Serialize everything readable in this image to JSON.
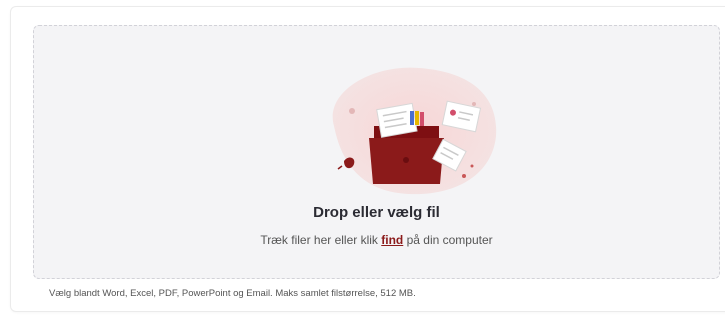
{
  "dropzone": {
    "heading": "Drop eller vælg fil",
    "sub_before": "Træk filer her eller klik ",
    "sub_link": "find",
    "sub_after": " på din computer"
  },
  "footer": {
    "note": "Vælg blandt Word, Excel, PDF, PowerPoint og Email. Maks samlet filstørrelse, 512 MB."
  },
  "colors": {
    "accent": "#8b1a1a",
    "dropzone_bg": "#f4f4f6"
  },
  "icons": {
    "illustration": "folder-with-documents-illustration"
  }
}
